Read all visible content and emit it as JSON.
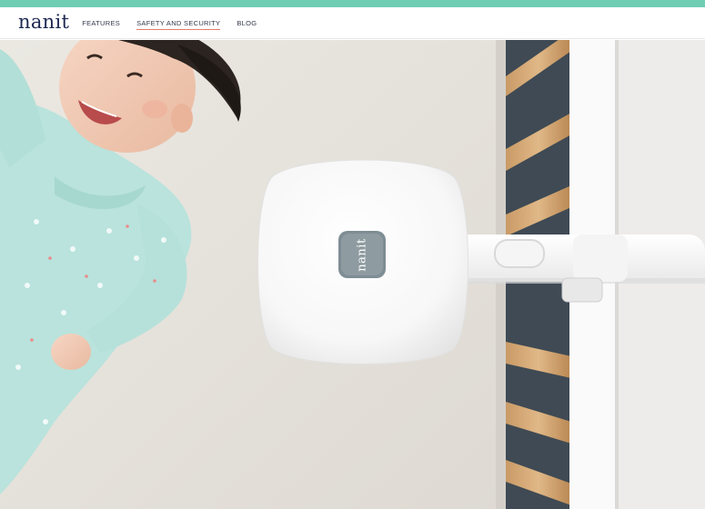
{
  "brand": {
    "logo_text": "nanit"
  },
  "nav": {
    "items": [
      {
        "label": "FEATURES",
        "active": false
      },
      {
        "label": "SAFETY AND SECURITY",
        "active": true
      },
      {
        "label": "BLOG",
        "active": false
      }
    ]
  },
  "hero": {
    "device_badge_text": "nanit"
  },
  "colors": {
    "accent_bar": "#6fcdb4",
    "logo": "#1d2951",
    "active_underline": "#e57e6a"
  }
}
